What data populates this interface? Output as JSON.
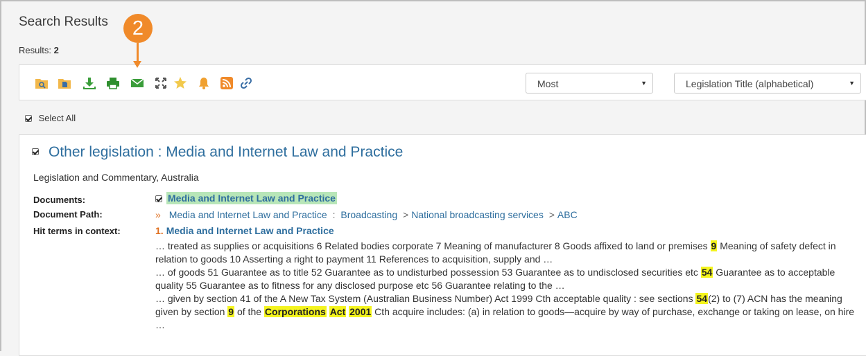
{
  "page": {
    "title": "Search Results",
    "results_label": "Results:",
    "results_count": "2"
  },
  "toolbar": {
    "icons": [
      "search-folder-icon",
      "document-folder-icon",
      "download-icon",
      "print-icon",
      "email-icon",
      "expand-icon",
      "star-icon",
      "bell-icon",
      "rss-icon",
      "link-icon"
    ],
    "colors": {
      "folder": "#f2b84b",
      "green": "#3a9d3a",
      "print": "#2f8f2f",
      "expand": "#555555",
      "star": "#f2c94c",
      "bell": "#f0a030",
      "rss": "#f08a2a",
      "link": "#3a6ea5"
    },
    "select_most": "Most",
    "select_sort": "Legislation Title (alphabetical)"
  },
  "callout": {
    "number": "2",
    "color": "#f08a2a"
  },
  "select_all_label": "Select All",
  "result": {
    "title": "Other legislation : Media and Internet Law and Practice",
    "subtitle": "Legislation and Commentary, Australia",
    "documents_label": "Documents:",
    "document_link": "Media and Internet Law and Practice",
    "path_label": "Document Path:",
    "path": [
      "Media and Internet Law and Practice",
      "Broadcasting",
      "National broadcasting services",
      "ABC"
    ],
    "hit_label": "Hit terms in context:",
    "hit_number": "1.",
    "hit_title": "Media and Internet Law and Practice",
    "context": [
      {
        "a": "… treated as supplies or acquisitions 6 Related bodies corporate 7 Meaning of manufacturer 8 Goods affixed to land or premises ",
        "h1": "9",
        "b": " Meaning of safety defect in relation to goods 10 Asserting a right to payment 11 References to acquisition, supply and …"
      },
      {
        "a": "… of goods 51 Guarantee as to title 52 Guarantee as to undisturbed possession 53 Guarantee as to undisclosed securities etc ",
        "h1": "54",
        "b": " Guarantee as to acceptable quality 55 Guarantee as to fitness for any disclosed purpose etc 56 Guarantee relating to the …"
      },
      {
        "a": "… given by section  41 of the A New Tax System (Australian Business Number) Act 1999 Cth acceptable quality : see sections  ",
        "h1": "54",
        "b": "(2) to (7) ACN has the meaning given by section  ",
        "h2": "9",
        "c": " of the ",
        "h3": "Corporations",
        "h4": "Act",
        "h5": "2001",
        "d": " Cth acquire includes: (a) in relation to goods—acquire by way of purchase, exchange or taking on lease, on hire …"
      }
    ]
  }
}
